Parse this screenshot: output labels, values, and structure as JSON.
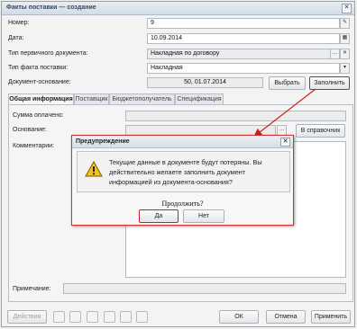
{
  "window": {
    "title": "Факты поставки — создание"
  },
  "form": {
    "number": {
      "label": "Номер:",
      "value": "9"
    },
    "date": {
      "label": "Дата:",
      "value": "10.09.2014"
    },
    "doc_type": {
      "label": "Тип первичного документа:",
      "value": "Накладная по договору"
    },
    "fact_type": {
      "label": "Тип факта поставки:",
      "value": "Накладная"
    },
    "base_doc": {
      "label": "Документ-основание:",
      "value": "50, 01.07.2014"
    },
    "select_button": "Выбрать",
    "fill_button": "Заполнить"
  },
  "tabs": [
    "Общая информация",
    "Поставщик",
    "Бюджетополучатель",
    "Спецификация"
  ],
  "panel": {
    "sum_paid_label": "Сумма оплачено:",
    "basis_label": "Основание:",
    "reference_button": "В справочник",
    "comment_label": "Комментарии:",
    "note_label": "Примечание:"
  },
  "bottom": {
    "actions_button": "Действия",
    "ok_button": "ОК",
    "cancel_button": "Отмена",
    "apply_button": "Применить"
  },
  "dialog": {
    "title": "Предупреждение",
    "message": "Текущие данные в документе будут потеряны. Вы действительно желаете заполнить документ информацией из документа-основания?",
    "prompt": "Продолжить?",
    "yes_button": "Да",
    "no_button": "Нет"
  },
  "colors": {
    "highlight": "#d11f1f"
  }
}
